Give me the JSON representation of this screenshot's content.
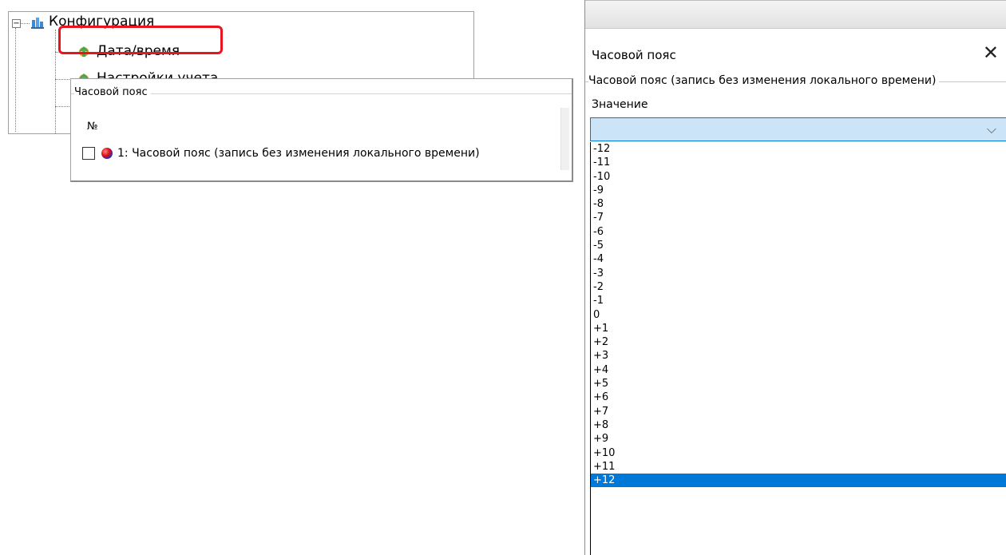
{
  "tree": {
    "root_label": "Конфигурация",
    "expander_symbol": "−",
    "items": [
      {
        "label": "Дата/время",
        "icon": "gear-green-icon"
      },
      {
        "label": "Настройки учета",
        "icon": "gear-green-icon"
      }
    ],
    "highlight_color": "#e8141e"
  },
  "popup": {
    "legend": "Часовой пояс",
    "column_header": "№",
    "rows": [
      {
        "label": "1: Часовой пояс (запись без изменения локального времени)",
        "checked": false
      }
    ]
  },
  "dialog": {
    "title": "Часовой пояс",
    "close_symbol": "✕",
    "group_label": "Часовой пояс (запись без изменения локального времени)",
    "value_label": "Значение",
    "combo_value": "",
    "chevron": "⌵",
    "options": [
      "-12",
      "-11",
      "-10",
      "-9",
      "-8",
      "-7",
      "-6",
      "-5",
      "-4",
      "-3",
      "-2",
      "-1",
      "0",
      "+1",
      "+2",
      "+3",
      "+4",
      "+5",
      "+6",
      "+7",
      "+8",
      "+9",
      "+10",
      "+11",
      "+12"
    ],
    "selected_option": "+12",
    "accent_color": "#0078d7"
  }
}
